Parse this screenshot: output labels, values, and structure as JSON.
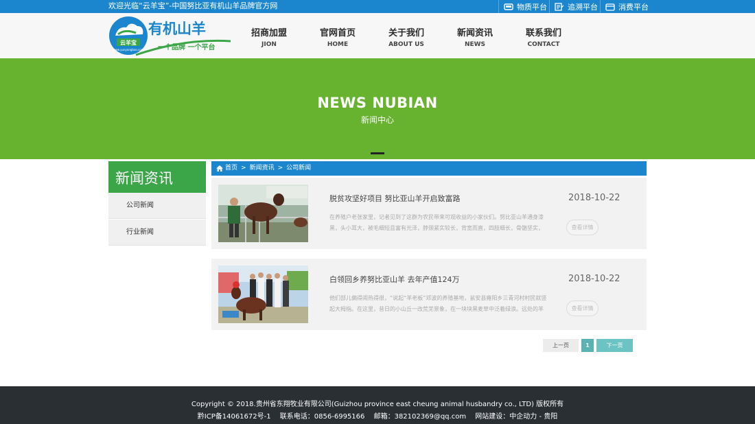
{
  "topbar": {
    "welcome": "欢迎光临“云羊宝”-中国努比亚有机山羊品牌官方网",
    "platforms": [
      {
        "label": "物质平台",
        "icon": "cart-icon"
      },
      {
        "label": "追溯平台",
        "icon": "trace-icon"
      },
      {
        "label": "消费平台",
        "icon": "wallet-icon"
      }
    ]
  },
  "logo": {
    "brand": "有机山羊",
    "badge": "云羊宝",
    "slogan": "一个品牌  一个平台",
    "url": "www.yunyangbao.com"
  },
  "nav": [
    {
      "cn": "招商加盟",
      "en": "JION"
    },
    {
      "cn": "官网首页",
      "en": "HOME"
    },
    {
      "cn": "关于我们",
      "en": "ABOUT US"
    },
    {
      "cn": "新闻资讯",
      "en": "NEWS"
    },
    {
      "cn": "联系我们",
      "en": "CONTACT"
    }
  ],
  "banner": {
    "title": "NEWS NUBIAN",
    "subtitle": "新闻中心"
  },
  "sidebar": {
    "heading": "新闻资讯",
    "items": [
      {
        "label": "公司新闻"
      },
      {
        "label": "行业新闻"
      }
    ]
  },
  "breadcrumb": {
    "home": "首页",
    "sep": ">",
    "level1": "新闻资讯",
    "level2": "公司新闻"
  },
  "news": [
    {
      "title": "脱贫攻坚好项目 努比亚山羊开启致富路",
      "date": "2018-10-22",
      "summary": "在养殖户老张家里，记者见到了这群为农民带来可观收益的小家伙们。努比亚山羊通身漆黑，头小耳大，被毛细短且富有光泽，脖颈紧实较长，背宽而直，四肢细长，骨骼坚实，乳",
      "more": "查看详情"
    },
    {
      "title": "白领回乡养努比亚山羊 去年产值124万",
      "date": "2018-10-22",
      "summary": "他们部儿偏得闹热得很，“说起“羊老板”邓波的养殖基地，瓮安县雍阳乡三青河村村民就竖起大拇指。在这里，昔日的小山丘一改荒芜景象，在一块块黑麦草中泛着绿浪。远处的羊棚在",
      "more": "查看详情"
    }
  ],
  "pagination": {
    "prev": "上一页",
    "current": "1",
    "next": "下一页"
  },
  "footer": {
    "copyright": "Copyright © 2018.贵州省东翔牧业有限公司(Guizhou province east cheung animal husbandry co., LTD) 版权所有",
    "icp": "黔ICP备14061672号-1",
    "phone": "联系电话：0856-6995166",
    "email": "邮箱：382102369@qq.com",
    "builder": "网站建设：中企动力 - 贵阳"
  },
  "colors": {
    "topbar": "#1b86cd",
    "banner": "#67b22e",
    "sidebar_head": "#3aa647",
    "footer": "#2a2f34",
    "page_active": "#5ab3b3"
  }
}
